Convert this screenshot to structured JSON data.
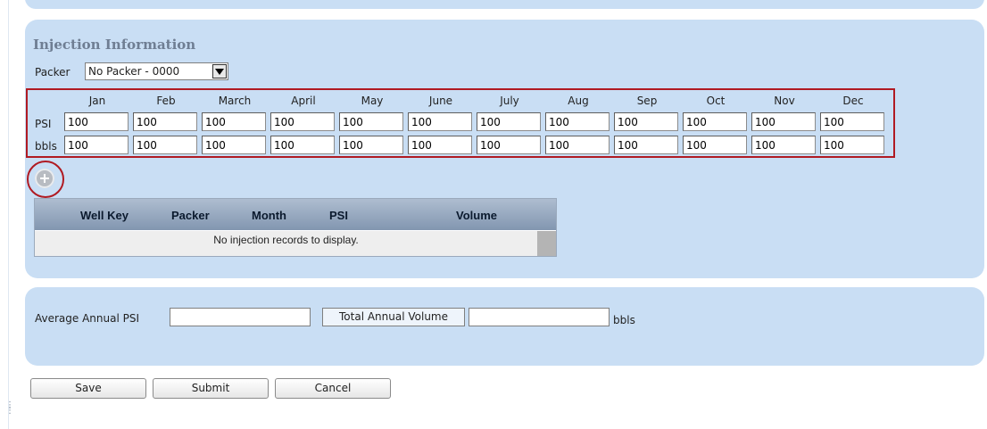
{
  "section": {
    "title": "Injection Information"
  },
  "packer": {
    "label": "Packer",
    "selected": "No Packer - 0000"
  },
  "months": [
    "Jan",
    "Feb",
    "March",
    "April",
    "May",
    "June",
    "July",
    "Aug",
    "Sep",
    "Oct",
    "Nov",
    "Dec"
  ],
  "rows": {
    "psi": {
      "label": "PSI",
      "values": [
        "100",
        "100",
        "100",
        "100",
        "100",
        "100",
        "100",
        "100",
        "100",
        "100",
        "100",
        "100"
      ]
    },
    "bbls": {
      "label": "bbls",
      "values": [
        "100",
        "100",
        "100",
        "100",
        "100",
        "100",
        "100",
        "100",
        "100",
        "100",
        "100",
        "100"
      ]
    }
  },
  "grid": {
    "columns": [
      "Well Key",
      "Packer",
      "Month",
      "PSI",
      "Volume"
    ],
    "empty_message": "No injection records to display."
  },
  "summary": {
    "avg_label": "Average Annual PSI",
    "avg_value": "",
    "total_label": "Total Annual Volume",
    "total_value": "",
    "unit": "bbls"
  },
  "buttons": {
    "save": "Save",
    "submit": "Submit",
    "cancel": "Cancel"
  },
  "icons": {
    "add": "plus-circle-icon",
    "dropdown": "chevron-down-icon",
    "grip": "resize-grip-icon"
  },
  "colors": {
    "panel": "#c9def4",
    "highlight": "#b01a22",
    "grid_header": "#8296b0"
  }
}
